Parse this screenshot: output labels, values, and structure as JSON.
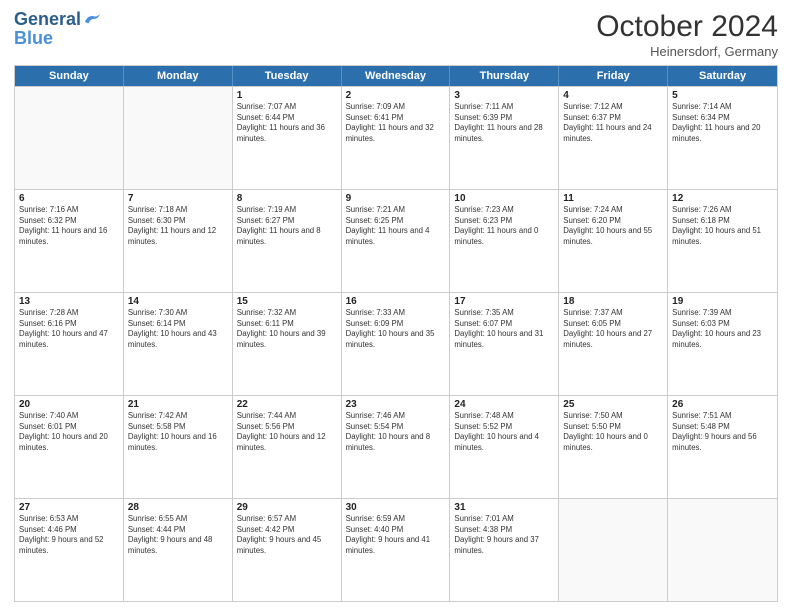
{
  "header": {
    "logo_general": "General",
    "logo_blue": "Blue",
    "month_title": "October 2024",
    "location": "Heinersdorf, Germany"
  },
  "weekdays": [
    "Sunday",
    "Monday",
    "Tuesday",
    "Wednesday",
    "Thursday",
    "Friday",
    "Saturday"
  ],
  "rows": [
    [
      {
        "day": "",
        "empty": true
      },
      {
        "day": "",
        "empty": true
      },
      {
        "day": "1",
        "sunrise": "Sunrise: 7:07 AM",
        "sunset": "Sunset: 6:44 PM",
        "daylight": "Daylight: 11 hours and 36 minutes."
      },
      {
        "day": "2",
        "sunrise": "Sunrise: 7:09 AM",
        "sunset": "Sunset: 6:41 PM",
        "daylight": "Daylight: 11 hours and 32 minutes."
      },
      {
        "day": "3",
        "sunrise": "Sunrise: 7:11 AM",
        "sunset": "Sunset: 6:39 PM",
        "daylight": "Daylight: 11 hours and 28 minutes."
      },
      {
        "day": "4",
        "sunrise": "Sunrise: 7:12 AM",
        "sunset": "Sunset: 6:37 PM",
        "daylight": "Daylight: 11 hours and 24 minutes."
      },
      {
        "day": "5",
        "sunrise": "Sunrise: 7:14 AM",
        "sunset": "Sunset: 6:34 PM",
        "daylight": "Daylight: 11 hours and 20 minutes."
      }
    ],
    [
      {
        "day": "6",
        "sunrise": "Sunrise: 7:16 AM",
        "sunset": "Sunset: 6:32 PM",
        "daylight": "Daylight: 11 hours and 16 minutes."
      },
      {
        "day": "7",
        "sunrise": "Sunrise: 7:18 AM",
        "sunset": "Sunset: 6:30 PM",
        "daylight": "Daylight: 11 hours and 12 minutes."
      },
      {
        "day": "8",
        "sunrise": "Sunrise: 7:19 AM",
        "sunset": "Sunset: 6:27 PM",
        "daylight": "Daylight: 11 hours and 8 minutes."
      },
      {
        "day": "9",
        "sunrise": "Sunrise: 7:21 AM",
        "sunset": "Sunset: 6:25 PM",
        "daylight": "Daylight: 11 hours and 4 minutes."
      },
      {
        "day": "10",
        "sunrise": "Sunrise: 7:23 AM",
        "sunset": "Sunset: 6:23 PM",
        "daylight": "Daylight: 11 hours and 0 minutes."
      },
      {
        "day": "11",
        "sunrise": "Sunrise: 7:24 AM",
        "sunset": "Sunset: 6:20 PM",
        "daylight": "Daylight: 10 hours and 55 minutes."
      },
      {
        "day": "12",
        "sunrise": "Sunrise: 7:26 AM",
        "sunset": "Sunset: 6:18 PM",
        "daylight": "Daylight: 10 hours and 51 minutes."
      }
    ],
    [
      {
        "day": "13",
        "sunrise": "Sunrise: 7:28 AM",
        "sunset": "Sunset: 6:16 PM",
        "daylight": "Daylight: 10 hours and 47 minutes."
      },
      {
        "day": "14",
        "sunrise": "Sunrise: 7:30 AM",
        "sunset": "Sunset: 6:14 PM",
        "daylight": "Daylight: 10 hours and 43 minutes."
      },
      {
        "day": "15",
        "sunrise": "Sunrise: 7:32 AM",
        "sunset": "Sunset: 6:11 PM",
        "daylight": "Daylight: 10 hours and 39 minutes."
      },
      {
        "day": "16",
        "sunrise": "Sunrise: 7:33 AM",
        "sunset": "Sunset: 6:09 PM",
        "daylight": "Daylight: 10 hours and 35 minutes."
      },
      {
        "day": "17",
        "sunrise": "Sunrise: 7:35 AM",
        "sunset": "Sunset: 6:07 PM",
        "daylight": "Daylight: 10 hours and 31 minutes."
      },
      {
        "day": "18",
        "sunrise": "Sunrise: 7:37 AM",
        "sunset": "Sunset: 6:05 PM",
        "daylight": "Daylight: 10 hours and 27 minutes."
      },
      {
        "day": "19",
        "sunrise": "Sunrise: 7:39 AM",
        "sunset": "Sunset: 6:03 PM",
        "daylight": "Daylight: 10 hours and 23 minutes."
      }
    ],
    [
      {
        "day": "20",
        "sunrise": "Sunrise: 7:40 AM",
        "sunset": "Sunset: 6:01 PM",
        "daylight": "Daylight: 10 hours and 20 minutes."
      },
      {
        "day": "21",
        "sunrise": "Sunrise: 7:42 AM",
        "sunset": "Sunset: 5:58 PM",
        "daylight": "Daylight: 10 hours and 16 minutes."
      },
      {
        "day": "22",
        "sunrise": "Sunrise: 7:44 AM",
        "sunset": "Sunset: 5:56 PM",
        "daylight": "Daylight: 10 hours and 12 minutes."
      },
      {
        "day": "23",
        "sunrise": "Sunrise: 7:46 AM",
        "sunset": "Sunset: 5:54 PM",
        "daylight": "Daylight: 10 hours and 8 minutes."
      },
      {
        "day": "24",
        "sunrise": "Sunrise: 7:48 AM",
        "sunset": "Sunset: 5:52 PM",
        "daylight": "Daylight: 10 hours and 4 minutes."
      },
      {
        "day": "25",
        "sunrise": "Sunrise: 7:50 AM",
        "sunset": "Sunset: 5:50 PM",
        "daylight": "Daylight: 10 hours and 0 minutes."
      },
      {
        "day": "26",
        "sunrise": "Sunrise: 7:51 AM",
        "sunset": "Sunset: 5:48 PM",
        "daylight": "Daylight: 9 hours and 56 minutes."
      }
    ],
    [
      {
        "day": "27",
        "sunrise": "Sunrise: 6:53 AM",
        "sunset": "Sunset: 4:46 PM",
        "daylight": "Daylight: 9 hours and 52 minutes."
      },
      {
        "day": "28",
        "sunrise": "Sunrise: 6:55 AM",
        "sunset": "Sunset: 4:44 PM",
        "daylight": "Daylight: 9 hours and 48 minutes."
      },
      {
        "day": "29",
        "sunrise": "Sunrise: 6:57 AM",
        "sunset": "Sunset: 4:42 PM",
        "daylight": "Daylight: 9 hours and 45 minutes."
      },
      {
        "day": "30",
        "sunrise": "Sunrise: 6:59 AM",
        "sunset": "Sunset: 4:40 PM",
        "daylight": "Daylight: 9 hours and 41 minutes."
      },
      {
        "day": "31",
        "sunrise": "Sunrise: 7:01 AM",
        "sunset": "Sunset: 4:38 PM",
        "daylight": "Daylight: 9 hours and 37 minutes."
      },
      {
        "day": "",
        "empty": true
      },
      {
        "day": "",
        "empty": true
      }
    ]
  ]
}
